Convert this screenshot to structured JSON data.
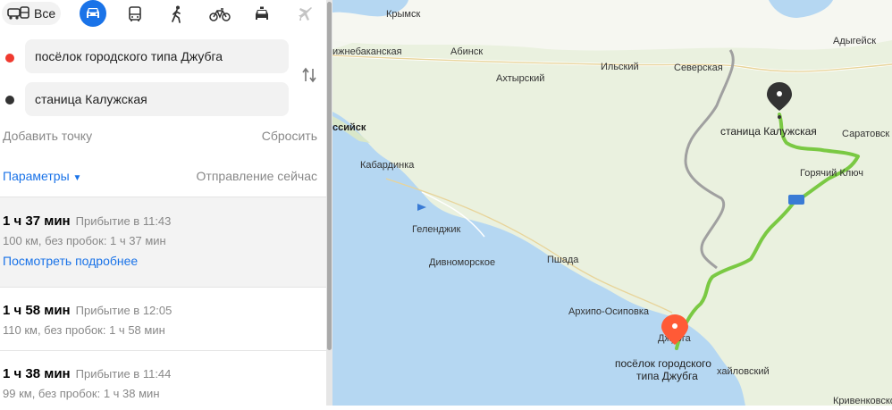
{
  "modes": {
    "all_label": "Все"
  },
  "inputs": {
    "from": "посёлок городского типа Джубга",
    "to": "станица Калужская"
  },
  "actions": {
    "add_point": "Добавить точку",
    "reset": "Сбросить"
  },
  "options": {
    "params": "Параметры",
    "depart": "Отправление сейчас"
  },
  "routes": [
    {
      "time": "1 ч 37 мин",
      "arrival": "Прибытие в 11:43",
      "dist": "100 км, без пробок: 1 ч 37 мин",
      "more": "Посмотреть подробнее"
    },
    {
      "time": "1 ч 58 мин",
      "arrival": "Прибытие в 12:05",
      "dist": "110 км, без пробок: 1 ч 58 мин"
    },
    {
      "time": "1 ч 38 мин",
      "arrival": "Прибытие в 11:44",
      "dist": "99 км, без пробок: 1 ч 38 мин"
    }
  ],
  "map": {
    "labels": {
      "krymsk": "Крымск",
      "adygeysk": "Адыгейск",
      "nizhnebakanskaya": "ижнебаканская",
      "abinsk": "Абинск",
      "ilsky": "Ильский",
      "severskaya": "Северская",
      "akhtyrsky": "Ахтырский",
      "novorossiysk": "ссийск",
      "kaluzhskaya": "станица Калужская",
      "saratovskaya": "Саратовск",
      "kabardinka": "Кабардинка",
      "goryachy_klyuch": "Горячий Ключ",
      "gelendzhik": "Геленджик",
      "divnomorskoe": "Дивноморское",
      "pshada": "Пшада",
      "arkhipo_osipovka": "Архипо-Осиповка",
      "dzhubga_small": "Джубга",
      "dzhubga_line1": "посёлок городского",
      "dzhubga_line2": "типа Джубга",
      "mikhailovsky": "хайловский",
      "krivenkovskoe": "Кривенковское"
    },
    "colors": {
      "route_main": "#7ac943",
      "route_alt": "#a0a0a0",
      "sea": "#b5d7f2",
      "land": "#eaf1df",
      "pin_start": "#ff5a36",
      "pin_end": "#333333"
    }
  }
}
